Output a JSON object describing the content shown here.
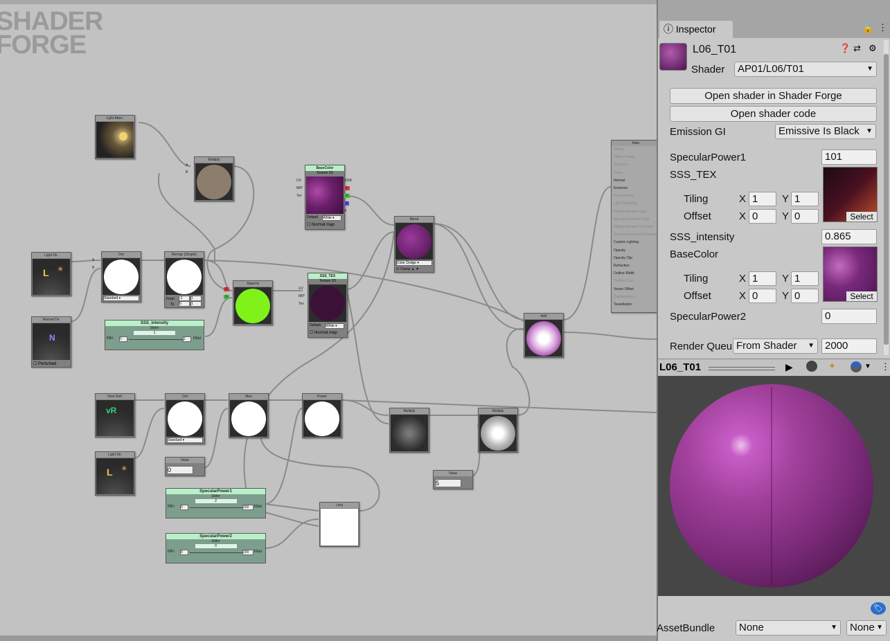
{
  "canvas": {
    "logo_line1": "SHADER",
    "logo_line2": "FORGE",
    "nodes": {
      "light_atten": "Light Atten.",
      "multiply1": "Multiply",
      "light_dir1": "Light Dir.",
      "dot1": "Dot",
      "dot1_mode": "Standard",
      "remap": "Remap (Simple)",
      "remap_from": "From",
      "remap_to": "To",
      "remap_from_a": "-1",
      "remap_from_b": "1",
      "remap_to_a": "0",
      "remap_to_b": "1",
      "normal_dir": "Normal Dir.",
      "perturbed": "Perturbed",
      "append": "Append",
      "basecolor": "BaseColor",
      "texture2d": "Texture 2D",
      "default": "Default",
      "white": "White",
      "normal_map": "Normal map",
      "sss_tex": "SSS_TEX",
      "blend": "Blend",
      "blend_mode": "Color Dodge",
      "clamp": "Clamp",
      "add": "Add",
      "main": "Main",
      "view_refl": "View Refl.",
      "light_dir2": "Light Dir.",
      "dot2": "Dot",
      "dot2_mode": "Standard",
      "value1": "Value",
      "value1_val": "0",
      "max": "Max",
      "power": "Power",
      "multiply2": "Multiply",
      "multiply3": "Multiply",
      "value2": "Value",
      "value2_val": "5",
      "lerp": "Lerp"
    },
    "sliders": {
      "sss_intensity": {
        "title": "SSS_intensity",
        "sub": "Slider",
        "value": "1",
        "min_label": "Min",
        "min": "0",
        "max_label": "Max",
        "max": "1"
      },
      "spec1": {
        "title": "SpecularPower1",
        "sub": "Slider",
        "value": "2",
        "min_label": "Min",
        "min": "0",
        "max_label": "Max",
        "max": "200"
      },
      "spec2": {
        "title": "SpecularPower2",
        "sub": "Slider",
        "value": "0",
        "min_label": "Min",
        "min": "0",
        "max_label": "Max",
        "max": "200"
      }
    },
    "main_inputs": [
      "Diffuse",
      "Diffuse Power",
      "Specular",
      "Gloss",
      "Normal",
      "Emission",
      "Transmission",
      "Light Wrapping",
      "Diffuse Ambient Light",
      "Specular Ambient Light",
      "Diffuse Ambient Occlusion",
      "Specular Ambient Occlusion",
      "Custom Lighting",
      "Opacity",
      "Opacity Clip",
      "Refraction",
      "Outline Width",
      "Outline Color",
      "Vertex Offset",
      "Displacement",
      "Tessellation"
    ]
  },
  "inspector": {
    "tab_label": "Inspector",
    "material_name": "L06_T01",
    "shader_label": "Shader",
    "shader_value": "AP01/L06/T01",
    "open_forge": "Open shader in Shader Forge",
    "open_code": "Open shader code",
    "emission_gi_label": "Emission GI",
    "emission_gi_value": "Emissive Is Black",
    "spec1_label": "SpecularPower1",
    "spec1_value": "101",
    "sss_tex_label": "SSS_TEX",
    "tiling_label": "Tiling",
    "offset_label": "Offset",
    "x_label": "X",
    "y_label": "Y",
    "sss_tiling_x": "1",
    "sss_tiling_y": "1",
    "sss_offset_x": "0",
    "sss_offset_y": "0",
    "select_label": "Select",
    "sss_intensity_label": "SSS_intensity",
    "sss_intensity_value": "0.865",
    "basecolor_label": "BaseColor",
    "bc_tiling_x": "1",
    "bc_tiling_y": "1",
    "bc_offset_x": "0",
    "bc_offset_y": "0",
    "spec2_label": "SpecularPower2",
    "spec2_value": "0",
    "render_queue_label": "Render Queue",
    "render_queue_mode": "From Shader",
    "render_queue_value": "2000",
    "preview_title": "L06_T01",
    "assetbundle_label": "AssetBundle",
    "assetbundle_value": "None",
    "assetbundle_variant": "None"
  },
  "colors": {
    "accent_green": "#b9f0c9",
    "append_green": "#7ff21a",
    "sphere_purple": "#a0409a"
  }
}
